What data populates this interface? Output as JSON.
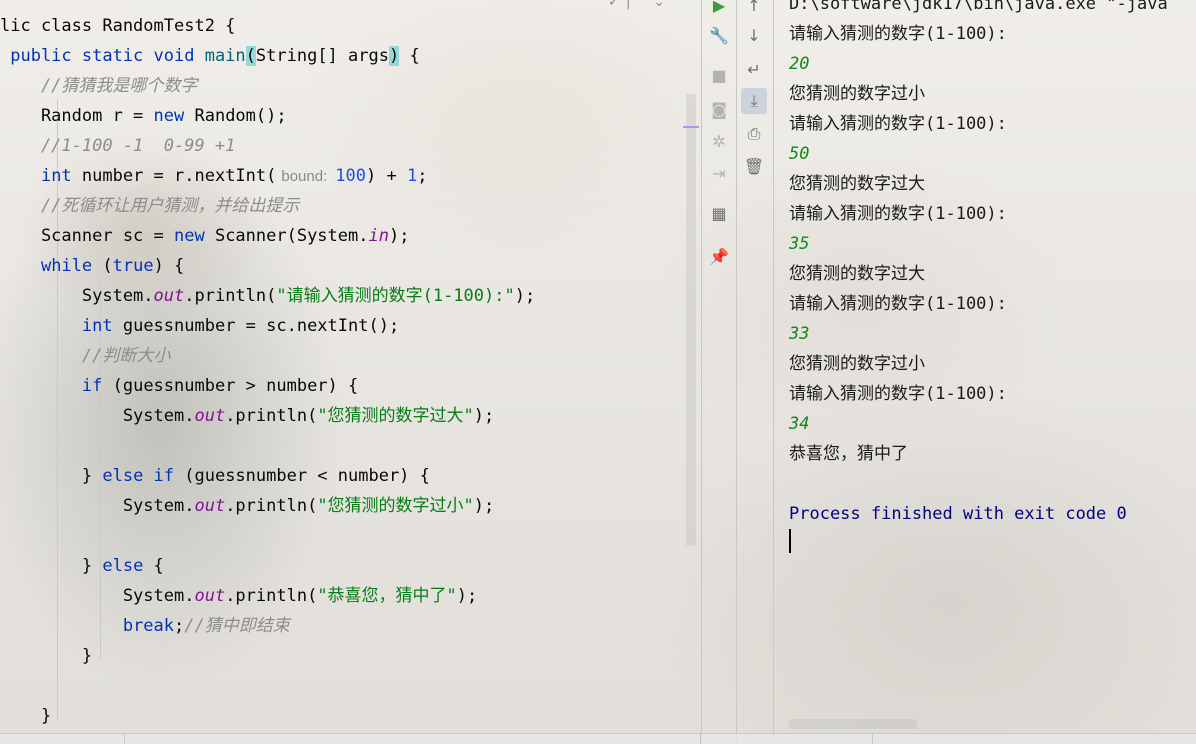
{
  "editor": {
    "lines": [
      {
        "parts": [
          {
            "t": "lic class RandomTest2 {",
            "c": ""
          }
        ]
      },
      {
        "parts": [
          {
            "t": " public static void ",
            "c": "kw"
          },
          {
            "t": "main",
            "c": "fn"
          },
          {
            "t": "(",
            "c": "paren-hl"
          },
          {
            "t": "String[] args",
            "c": ""
          },
          {
            "t": ")",
            "c": "paren-hl"
          },
          {
            "t": " {",
            "c": ""
          }
        ]
      },
      {
        "parts": [
          {
            "t": "    //猜猜我是哪个数字",
            "c": "cmt"
          }
        ]
      },
      {
        "parts": [
          {
            "t": "    Random r = ",
            "c": ""
          },
          {
            "t": "new",
            "c": "kw"
          },
          {
            "t": " Random();",
            "c": ""
          }
        ]
      },
      {
        "parts": [
          {
            "t": "    //1-100 -1  0-99 +1",
            "c": "cmt"
          }
        ]
      },
      {
        "parts": [
          {
            "t": "    ",
            "c": ""
          },
          {
            "t": "int",
            "c": "kw"
          },
          {
            "t": " number = r.nextInt(",
            "c": ""
          },
          {
            "t": "bound:",
            "c": "hint"
          },
          {
            "t": "100",
            "c": "num"
          },
          {
            "t": ") + ",
            "c": ""
          },
          {
            "t": "1",
            "c": "num"
          },
          {
            "t": ";",
            "c": ""
          }
        ]
      },
      {
        "parts": [
          {
            "t": "    //死循环让用户猜测，并给出提示",
            "c": "cmt"
          }
        ]
      },
      {
        "parts": [
          {
            "t": "    Scanner sc = ",
            "c": ""
          },
          {
            "t": "new",
            "c": "kw"
          },
          {
            "t": " Scanner(System.",
            "c": ""
          },
          {
            "t": "in",
            "c": "fld"
          },
          {
            "t": ");",
            "c": ""
          }
        ]
      },
      {
        "parts": [
          {
            "t": "    ",
            "c": ""
          },
          {
            "t": "while",
            "c": "kw"
          },
          {
            "t": " (",
            "c": ""
          },
          {
            "t": "true",
            "c": "kw"
          },
          {
            "t": ") {",
            "c": ""
          }
        ]
      },
      {
        "parts": [
          {
            "t": "        System.",
            "c": ""
          },
          {
            "t": "out",
            "c": "fld"
          },
          {
            "t": ".println(",
            "c": ""
          },
          {
            "t": "\"请输入猜测的数字(1-100):\"",
            "c": "str"
          },
          {
            "t": ");",
            "c": ""
          }
        ]
      },
      {
        "parts": [
          {
            "t": "        ",
            "c": ""
          },
          {
            "t": "int",
            "c": "kw"
          },
          {
            "t": " guessnumber = sc.nextInt();",
            "c": ""
          }
        ]
      },
      {
        "parts": [
          {
            "t": "        //判断大小",
            "c": "cmt"
          }
        ]
      },
      {
        "parts": [
          {
            "t": "        ",
            "c": ""
          },
          {
            "t": "if",
            "c": "kw"
          },
          {
            "t": " (guessnumber > number) {",
            "c": ""
          }
        ]
      },
      {
        "parts": [
          {
            "t": "            System.",
            "c": ""
          },
          {
            "t": "out",
            "c": "fld"
          },
          {
            "t": ".println(",
            "c": ""
          },
          {
            "t": "\"您猜测的数字过大\"",
            "c": "str"
          },
          {
            "t": ");",
            "c": ""
          }
        ]
      },
      {
        "parts": [
          {
            "t": "",
            "c": ""
          }
        ]
      },
      {
        "parts": [
          {
            "t": "        } ",
            "c": ""
          },
          {
            "t": "else if",
            "c": "kw"
          },
          {
            "t": " (guessnumber < number) {",
            "c": ""
          }
        ]
      },
      {
        "parts": [
          {
            "t": "            System.",
            "c": ""
          },
          {
            "t": "out",
            "c": "fld"
          },
          {
            "t": ".println(",
            "c": ""
          },
          {
            "t": "\"您猜测的数字过小\"",
            "c": "str"
          },
          {
            "t": ");",
            "c": ""
          }
        ]
      },
      {
        "parts": [
          {
            "t": "",
            "c": ""
          }
        ]
      },
      {
        "parts": [
          {
            "t": "        } ",
            "c": ""
          },
          {
            "t": "else",
            "c": "kw"
          },
          {
            "t": " {",
            "c": ""
          }
        ]
      },
      {
        "parts": [
          {
            "t": "            System.",
            "c": ""
          },
          {
            "t": "out",
            "c": "fld"
          },
          {
            "t": ".println(",
            "c": ""
          },
          {
            "t": "\"恭喜您，猜中了\"",
            "c": "str"
          },
          {
            "t": ");",
            "c": ""
          }
        ]
      },
      {
        "parts": [
          {
            "t": "            ",
            "c": ""
          },
          {
            "t": "break",
            "c": "kw"
          },
          {
            "t": ";",
            "c": ""
          },
          {
            "t": "//猜中即结束",
            "c": "cmt"
          }
        ]
      },
      {
        "parts": [
          {
            "t": "        }",
            "c": ""
          }
        ]
      },
      {
        "parts": [
          {
            "t": "",
            "c": ""
          }
        ]
      },
      {
        "parts": [
          {
            "t": "    }",
            "c": ""
          }
        ]
      }
    ]
  },
  "toolbar_left": [
    {
      "name": "rerun-icon",
      "glyph": "▶",
      "color": "#3a9b3a"
    },
    {
      "name": "wrench-icon",
      "glyph": "🔧",
      "color": "#6e6e6e"
    },
    {
      "name": "stop-icon",
      "glyph": "■",
      "color": "#b3b3b3"
    },
    {
      "name": "camera-icon",
      "glyph": "◙",
      "color": "#b3b3b3"
    },
    {
      "name": "debug-bug-icon",
      "glyph": "✲",
      "color": "#b3b3b3"
    },
    {
      "name": "exit-icon",
      "glyph": "⇥",
      "color": "#b3b3b3"
    },
    {
      "name": "layout-icon",
      "glyph": "▦",
      "color": "#6e6e6e"
    },
    {
      "name": "pin-icon",
      "glyph": "📌",
      "color": "#6e6e6e"
    }
  ],
  "toolbar_right": [
    {
      "name": "scroll-up-icon",
      "glyph": "↑"
    },
    {
      "name": "scroll-down-icon",
      "glyph": "↓"
    },
    {
      "name": "soft-wrap-icon",
      "glyph": "↵"
    },
    {
      "name": "scroll-to-end-icon",
      "glyph": "⤓"
    },
    {
      "name": "print-icon",
      "glyph": "⎙"
    },
    {
      "name": "trash-icon",
      "glyph": "🗑"
    }
  ],
  "console": {
    "lines": [
      {
        "t": "D:\\software\\jdk17\\bin\\java.exe \"-java",
        "k": "con-out"
      },
      {
        "t": "请输入猜测的数字(1-100):",
        "k": "con-out"
      },
      {
        "t": "20",
        "k": "con-in"
      },
      {
        "t": "您猜测的数字过小",
        "k": "con-out"
      },
      {
        "t": "请输入猜测的数字(1-100):",
        "k": "con-out"
      },
      {
        "t": "50",
        "k": "con-in"
      },
      {
        "t": "您猜测的数字过大",
        "k": "con-out"
      },
      {
        "t": "请输入猜测的数字(1-100):",
        "k": "con-out"
      },
      {
        "t": "35",
        "k": "con-in"
      },
      {
        "t": "您猜测的数字过大",
        "k": "con-out"
      },
      {
        "t": "请输入猜测的数字(1-100):",
        "k": "con-out"
      },
      {
        "t": "33",
        "k": "con-in"
      },
      {
        "t": "您猜测的数字过小",
        "k": "con-out"
      },
      {
        "t": "请输入猜测的数字(1-100):",
        "k": "con-out"
      },
      {
        "t": "34",
        "k": "con-in"
      },
      {
        "t": "恭喜您，猜中了",
        "k": "con-out"
      },
      {
        "t": "",
        "k": "con-out"
      },
      {
        "t": "Process finished with exit code 0",
        "k": "con-sys"
      }
    ]
  }
}
